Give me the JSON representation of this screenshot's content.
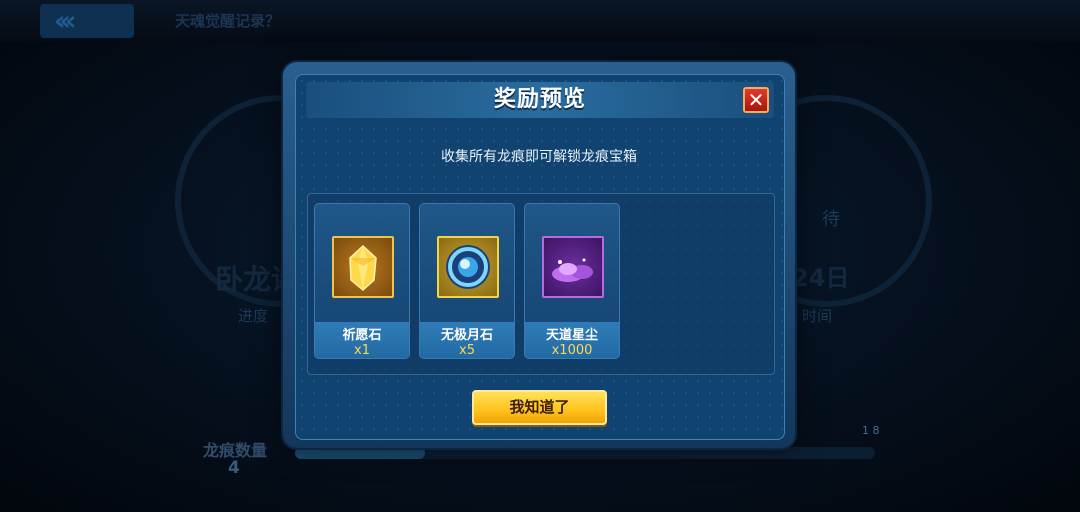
{
  "background": {
    "page_title": "天魂觉醒记录？",
    "left_name": "卧龙诸",
    "right_date": "24日",
    "left_label": "进度",
    "right_label": "时间",
    "right_top": "待",
    "dragon_count_label": "龙痕数量",
    "dragon_count_value": "4",
    "progress_marker": "1 8"
  },
  "modal": {
    "title": "奖励预览",
    "close_symbol": "✕",
    "subtitle": "收集所有龙痕即可解锁龙痕宝箱",
    "items": [
      {
        "name": "祈愿石",
        "count": "x1",
        "icon": "golden-crystal-icon",
        "rarity_color": "#f0c34b"
      },
      {
        "name": "无极月石",
        "count": "x5",
        "icon": "blue-moon-orb-icon",
        "rarity_color": "#f0d44b"
      },
      {
        "name": "天道星尘",
        "count": "x1000",
        "icon": "purple-stardust-icon",
        "rarity_color": "#b56ae0"
      }
    ],
    "confirm_label": "我知道了"
  },
  "colors": {
    "accent_button": "#ffc21a",
    "panel_blue": "#10436f",
    "close_red": "#d12a1f"
  }
}
